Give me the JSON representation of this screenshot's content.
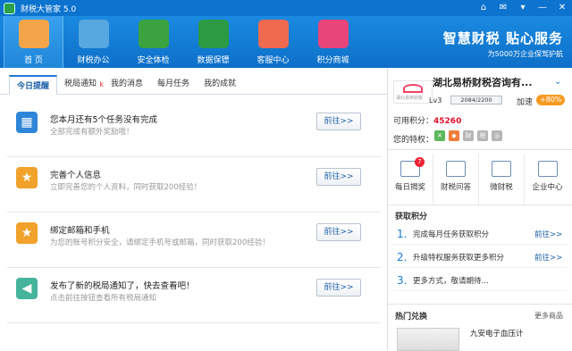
{
  "app": {
    "title": "财税大管家 5.0"
  },
  "window_buttons": [
    "⌂",
    "✉",
    "▾",
    "—",
    "✕"
  ],
  "nav": [
    {
      "label": "首 页",
      "icon": "home-icon",
      "color": "#f4a54a",
      "active": true
    },
    {
      "label": "财税办公",
      "icon": "office-icon",
      "color": "#57a7e0"
    },
    {
      "label": "安全体检",
      "icon": "checkup-icon",
      "color": "#3aa33f"
    },
    {
      "label": "数据保镖",
      "icon": "lock-icon",
      "color": "#2b9a43"
    },
    {
      "label": "客服中心",
      "icon": "calendar-heart-icon",
      "color": "#f06a50"
    },
    {
      "label": "积分商城",
      "icon": "gift-icon",
      "color": "#e8457a"
    }
  ],
  "brand": {
    "line1": "智慧财税  贴心服务",
    "line2": "为5000万企业保驾护航"
  },
  "tabs": [
    {
      "label": "今日提醒",
      "active": true
    },
    {
      "label": "税局通知",
      "badge": "k"
    },
    {
      "label": "我的消息"
    },
    {
      "label": "每月任务"
    },
    {
      "label": "我的成就"
    }
  ],
  "tasks": [
    {
      "title": "您本月还有5个任务没有完成",
      "desc": "全部完成有额外奖励哦！",
      "button": "前往>>",
      "icon": "calendar-icon",
      "color": "#2f86d8"
    },
    {
      "title": "完善个人信息",
      "desc": "立即完善您的个人资料，同时获取200经验！",
      "button": "前往>>",
      "icon": "star-icon",
      "color": "#f0a22b"
    },
    {
      "title": "绑定邮箱和手机",
      "desc": "为您的账号积分安全，请绑定手机号或邮箱，同时获取200经验！",
      "button": "前往>>",
      "icon": "star-icon",
      "color": "#f0a22b"
    },
    {
      "title": "发布了新的税局通知了，快去查看吧！",
      "desc": "点击前往按钮查看所有税局通知",
      "button": "前往>>",
      "icon": "speaker-icon",
      "color": "#46b39b"
    }
  ],
  "user": {
    "company": "湖北易桥财税咨询有...",
    "level": "Lv3",
    "level_progress_text": "2084/2200",
    "level_progress": 0.947,
    "speed_label": "加速",
    "speed_badge": "+80%",
    "points_label": "可用积分：",
    "points_value": "45260",
    "privilege_label": "您的特权：",
    "privileges": [
      {
        "icon": "privilege-green-icon",
        "color": "#5cb85c",
        "glyph": "✕"
      },
      {
        "icon": "privilege-orange-icon",
        "color": "#f07c3a",
        "glyph": "◆"
      },
      {
        "icon": "privilege-gray1-icon",
        "color": "#b5b5b5",
        "glyph": "財"
      },
      {
        "icon": "privilege-gray2-icon",
        "color": "#b5b5b5",
        "glyph": "税"
      },
      {
        "icon": "privilege-gray3-icon",
        "color": "#b5b5b5",
        "glyph": "◎"
      }
    ],
    "logo_text": "湖北易桥财税"
  },
  "tools": [
    {
      "label": "每日揭奖",
      "icon": "lottery-icon",
      "badge": "7"
    },
    {
      "label": "财税问答",
      "icon": "qa-icon"
    },
    {
      "label": "微财税",
      "icon": "weibo-tax-icon"
    },
    {
      "label": "企业中心",
      "icon": "enterprise-icon"
    }
  ],
  "earn": {
    "title": "获取积分",
    "items": [
      {
        "num": "1.",
        "text": "完成每月任务获取积分",
        "go": "前往>>"
      },
      {
        "num": "2.",
        "text": "升级特权服务获取更多积分",
        "go": "前往>>"
      },
      {
        "num": "3.",
        "text": "更多方式，敬请期待...",
        "go": ""
      }
    ]
  },
  "hot": {
    "title": "热门兑换",
    "more": "更多商品",
    "product": "九安电子血压计"
  }
}
